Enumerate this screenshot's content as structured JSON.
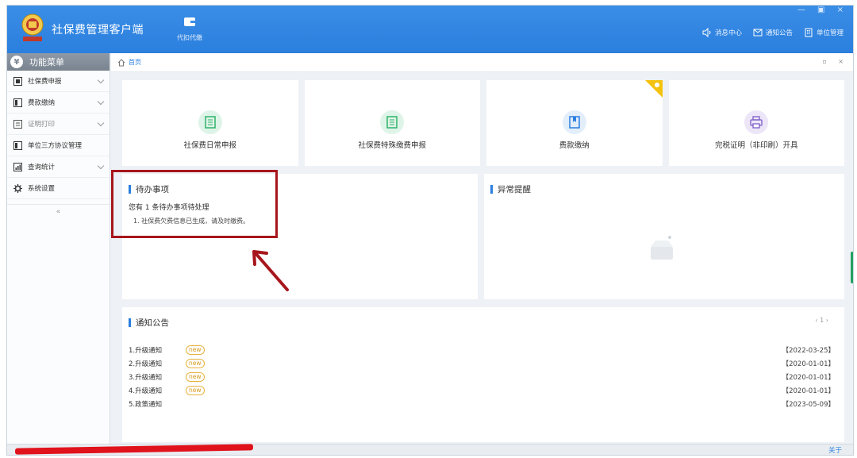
{
  "app": {
    "title": "社保费管理客户端",
    "window_controls": "— ▣ ×"
  },
  "header": {
    "nav_agent_label": "代扣代缴",
    "links": [
      {
        "label": "消息中心",
        "icon": "speaker-icon"
      },
      {
        "label": "通知公告",
        "icon": "mail-icon"
      },
      {
        "label": "单位管理",
        "icon": "building-icon"
      }
    ]
  },
  "sidebar": {
    "title": "功能菜单",
    "items": [
      {
        "label": "社保费申报",
        "expandable": true
      },
      {
        "label": "费款缴纳",
        "expandable": true
      },
      {
        "label": "证明打印",
        "expandable": true
      },
      {
        "label": "单位三方协议管理",
        "expandable": false
      },
      {
        "label": "查询统计",
        "expandable": true
      },
      {
        "label": "系统设置",
        "expandable": false
      }
    ],
    "collapse_label": "«"
  },
  "breadcrumb": {
    "home_label": "首页",
    "tab_tools": "▫ ×"
  },
  "tiles": [
    {
      "label": "社保费日常申报",
      "icon": "document-icon",
      "color": "#2fb36a",
      "bg": "#dff4e8"
    },
    {
      "label": "社保费特殊缴费申报",
      "icon": "document-icon",
      "color": "#2fb36a",
      "bg": "#dff4e8"
    },
    {
      "label": "费款缴纳",
      "icon": "bookmark-icon",
      "color": "#2b7fde",
      "bg": "#e3eefb"
    },
    {
      "label": "完税证明（非印刷）开具",
      "icon": "printer-icon",
      "color": "#7d5cc8",
      "bg": "#ece6f8"
    }
  ],
  "todo": {
    "title": "待办事项",
    "count_text": "您有 1 条待办事项待处理",
    "items": [
      "1. 社保费欠费信息已生成，请及时缴费。"
    ]
  },
  "alerts": {
    "title": "异常提醒"
  },
  "notices": {
    "title": "通知公告",
    "pager": "‹ 1 ›",
    "badge_label": "new",
    "rows": [
      {
        "title": "1.升级通知",
        "new": true,
        "date": "【2022-03-25】"
      },
      {
        "title": "2.升级通知",
        "new": true,
        "date": "【2020-01-01】"
      },
      {
        "title": "3.升级通知",
        "new": true,
        "date": "【2020-01-01】"
      },
      {
        "title": "4.升级通知",
        "new": true,
        "date": "【2020-01-01】"
      },
      {
        "title": "5.政策通知",
        "new": false,
        "date": "【2023-05-09】"
      }
    ]
  },
  "statusbar": {
    "about_label": "关于"
  },
  "colors": {
    "accent": "#2b7fde",
    "annotation_red": "#a7161c"
  }
}
